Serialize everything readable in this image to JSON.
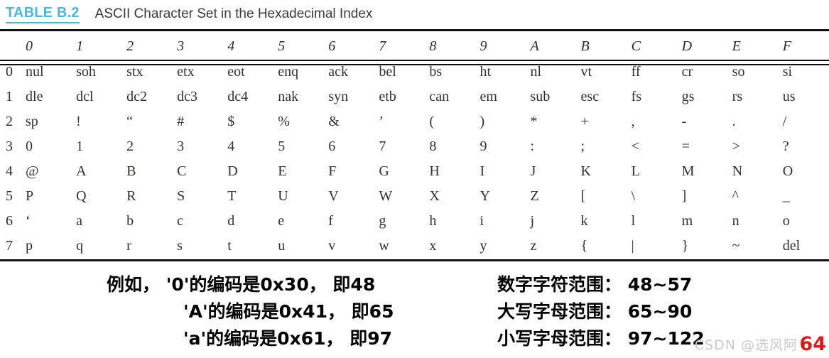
{
  "header": {
    "table_label": "TABLE B.2",
    "caption": "ASCII Character Set in the Hexadecimal Index",
    "label_color": "#4FB6D6",
    "caption_color": "#3A3A3A"
  },
  "table": {
    "corner_label": "",
    "column_headers": [
      "0",
      "1",
      "2",
      "3",
      "4",
      "5",
      "6",
      "7",
      "8",
      "9",
      "A",
      "B",
      "C",
      "D",
      "E",
      "F"
    ],
    "row_headers": [
      "0",
      "1",
      "2",
      "3",
      "4",
      "5",
      "6",
      "7"
    ],
    "rows": [
      [
        "nul",
        "soh",
        "stx",
        "etx",
        "eot",
        "enq",
        "ack",
        "bel",
        "bs",
        "ht",
        "nl",
        "vt",
        "ff",
        "cr",
        "so",
        "si"
      ],
      [
        "dle",
        "dcl",
        "dc2",
        "dc3",
        "dc4",
        "nak",
        "syn",
        "etb",
        "can",
        "em",
        "sub",
        "esc",
        "fs",
        "gs",
        "rs",
        "us"
      ],
      [
        "sp",
        "!",
        "“",
        "#",
        "$",
        "%",
        "&",
        "’",
        "(",
        ")",
        "*",
        "+",
        ",",
        "-",
        ".",
        "/"
      ],
      [
        "0",
        "1",
        "2",
        "3",
        "4",
        "5",
        "6",
        "7",
        "8",
        "9",
        ":",
        ";",
        "<",
        "=",
        ">",
        "?"
      ],
      [
        "@",
        "A",
        "B",
        "C",
        "D",
        "E",
        "F",
        "G",
        "H",
        "I",
        "J",
        "K",
        "L",
        "M",
        "N",
        "O"
      ],
      [
        "P",
        "Q",
        "R",
        "S",
        "T",
        "U",
        "V",
        "W",
        "X",
        "Y",
        "Z",
        "[",
        "\\",
        "]",
        "^",
        "_"
      ],
      [
        "‘",
        "a",
        "b",
        "c",
        "d",
        "e",
        "f",
        "g",
        "h",
        "i",
        "j",
        "k",
        "l",
        "m",
        "n",
        "o"
      ],
      [
        "p",
        "q",
        "r",
        "s",
        "t",
        "u",
        "v",
        "w",
        "x",
        "y",
        "z",
        "{",
        "|",
        "}",
        "~",
        "del"
      ]
    ]
  },
  "annotations": {
    "left": {
      "line1": "例如，  '0'的编码是0x30， 即48",
      "line2": "'A'的编码是0x41， 即65",
      "line3": "'a'的编码是0x61，  即97"
    },
    "right": {
      "line1": "数字字符范围： 48~57",
      "line2": "大写字母范围： 65~90",
      "line3": "小写字母范围： 97~122"
    }
  },
  "watermark": {
    "text": "CSDN @选风阿"
  },
  "page": {
    "number": "64",
    "number_color": "#D41E1E"
  }
}
